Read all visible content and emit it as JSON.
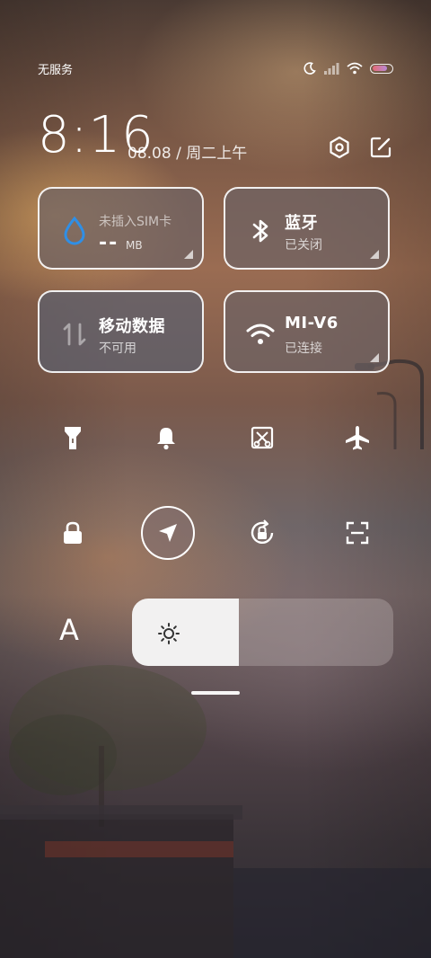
{
  "status": {
    "carrier": "无服务",
    "icons": [
      "moon-icon",
      "signal-icon",
      "wifi-icon",
      "battery-icon"
    ],
    "battery_level": 0.8
  },
  "clock": {
    "time": "8:16",
    "date": "08.08 / 周二上午"
  },
  "header_icons": [
    "settings-icon",
    "edit-icon"
  ],
  "tiles": {
    "data_usage": {
      "label": "未插入SIM卡",
      "value": "--",
      "unit": "MB",
      "icon": "water-drop-icon"
    },
    "bluetooth": {
      "title": "蓝牙",
      "status": "已关闭",
      "icon": "bluetooth-icon"
    },
    "mobile_data": {
      "title": "移动数据",
      "status": "不可用",
      "icon": "data-arrows-icon"
    },
    "wifi": {
      "title": "MI-V6",
      "status": "已连接",
      "icon": "wifi-icon"
    }
  },
  "toggles_row1": [
    "flashlight-icon",
    "bell-icon",
    "screenshot-icon",
    "airplane-icon"
  ],
  "toggles_row2": [
    "lock-icon",
    "location-icon",
    "rotation-lock-icon",
    "scan-icon"
  ],
  "brightness": {
    "level": 0.41,
    "font_label": "A"
  },
  "colors": {
    "accent_blue": "#2f8fe6",
    "tile_border": "#ffffff"
  }
}
